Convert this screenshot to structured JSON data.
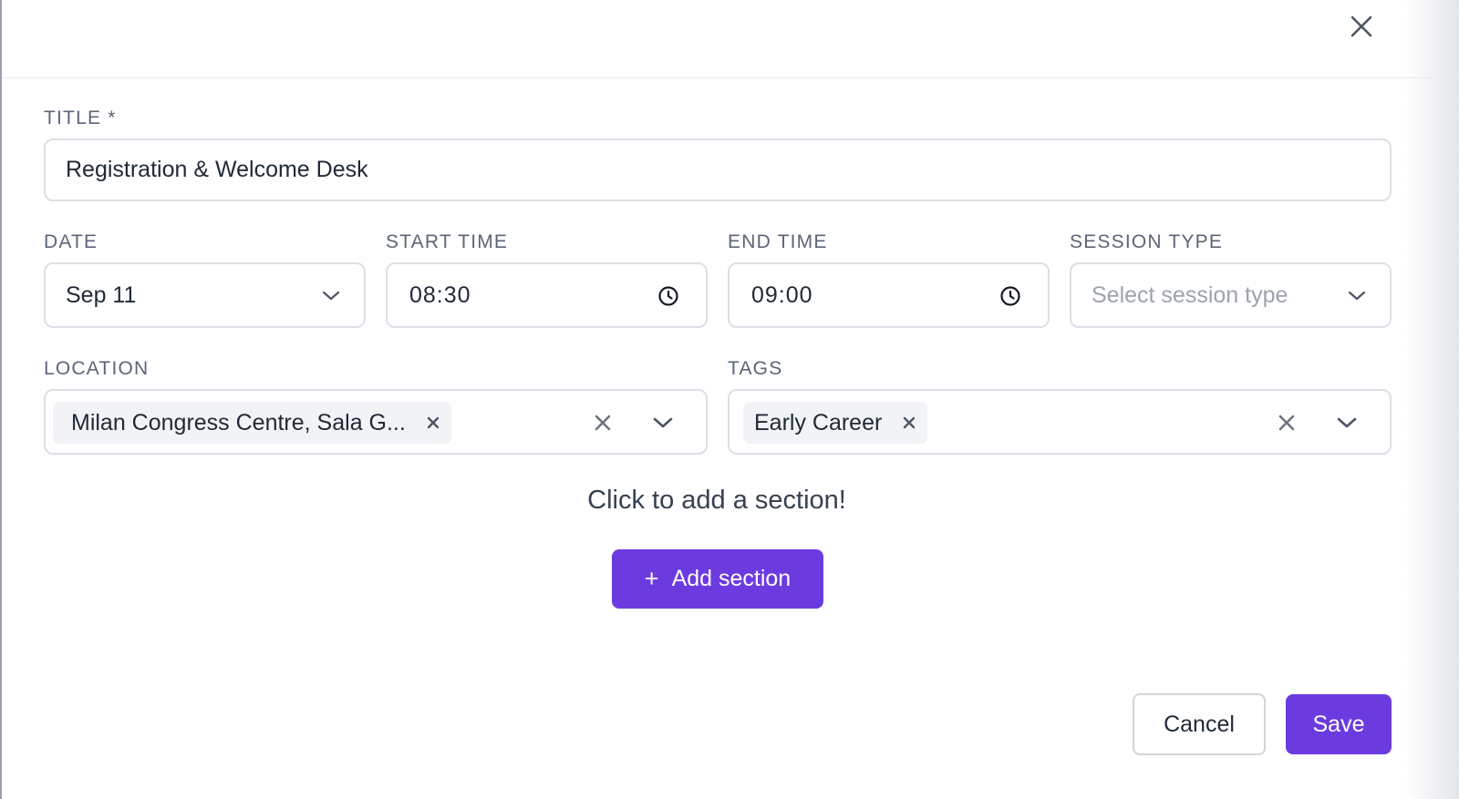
{
  "title_field": {
    "label": "TITLE *",
    "value": "Registration & Welcome Desk"
  },
  "date_field": {
    "label": "DATE",
    "value": "Sep 11"
  },
  "start_time_field": {
    "label": "START TIME",
    "value": "08:30"
  },
  "end_time_field": {
    "label": "END TIME",
    "value": "09:00"
  },
  "session_type_field": {
    "label": "SESSION TYPE",
    "placeholder": "Select session type"
  },
  "location_field": {
    "label": "LOCATION",
    "chips": [
      "Milan Congress Centre, Sala G..."
    ]
  },
  "tags_field": {
    "label": "TAGS",
    "chips": [
      "Early Career"
    ]
  },
  "sections": {
    "empty_hint": "Click to add a section!",
    "add_button_icon": "+",
    "add_button_label": "Add section"
  },
  "footer": {
    "cancel_label": "Cancel",
    "save_label": "Save"
  },
  "icons": {
    "close": "close-icon",
    "chevron": "chevron-down-icon",
    "clock": "clock-icon",
    "clear": "clear-icon"
  },
  "colors": {
    "primary": "#6b3be0",
    "border": "#dcdfe6",
    "label": "#5b6577",
    "chip_bg": "#f1f3f6"
  }
}
